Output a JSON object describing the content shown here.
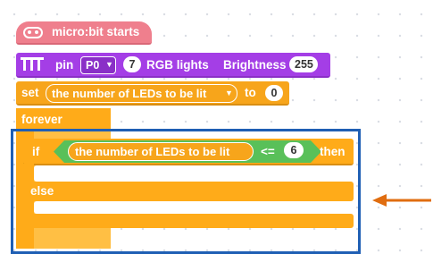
{
  "start_block": {
    "label": "micro:bit starts"
  },
  "rgb_block": {
    "pin_label": "pin",
    "pin_value": "P0",
    "count_value": "7",
    "rgb_label": "RGB lights",
    "brightness_label": "Brightness",
    "brightness_value": "255"
  },
  "set_block": {
    "set_label": "set",
    "variable": "the number of LEDs to be lit",
    "to_label": "to",
    "value": "0"
  },
  "forever_block": {
    "label": "forever"
  },
  "if_block": {
    "if_label": "if",
    "condition_variable": "the number of LEDs to be lit",
    "operator": "<=",
    "compare_value": "6",
    "then_label": "then",
    "else_label": "else"
  },
  "colors": {
    "event_pink": "#ef7f8d",
    "rgb_purple": "#a43ee6",
    "variable_orange": "#f7a51b",
    "control_orange": "#ffab19",
    "logic_green": "#59c059",
    "highlight_blue": "#1f5fb4",
    "arrow_orange": "#e06d10"
  }
}
